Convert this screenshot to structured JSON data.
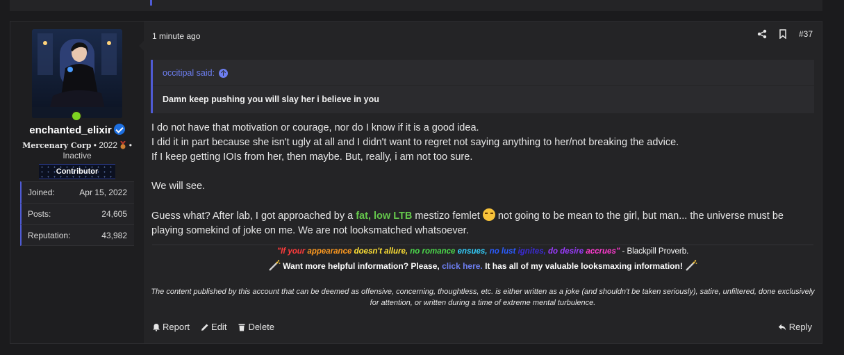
{
  "post": {
    "timestamp": "1 minute ago",
    "post_number": "#37",
    "user": {
      "name": "enchanted_elixir",
      "title_gothic": "Mercenary Corp",
      "title_rest": " • 2022 ",
      "title_end": " •",
      "status": "Inactive",
      "banner": "Contributor",
      "stats": [
        {
          "label": "Joined:",
          "value": "Apr 15, 2022"
        },
        {
          "label": "Posts:",
          "value": "24,605"
        },
        {
          "label": "Reputation:",
          "value": "43,982"
        }
      ]
    },
    "quote": {
      "author": "occitipal said:",
      "text": "Damn keep pushing you will slay her i believe in you"
    },
    "body": {
      "p1": "I do not have that motivation or courage, nor do I know if it is a good idea.",
      "p2": "I did it in part because she isn't ugly at all and I didn't want to regret not saying anything to her/not breaking the advice.",
      "p3": "If I keep getting IOIs from her, then maybe. But, really, i am not too sure.",
      "p4": "We will see.",
      "p5_start": "Guess what? After lab, I got approached by a ",
      "p5_green": "fat, low LTB",
      "p5_mid": " mestizo femlet ",
      "p5_end": " not going to be mean to the girl, but man... the universe must be playing somekind of joke on me. We are not looksmatched whatsoever."
    },
    "signature": {
      "quote_parts": [
        {
          "text": "\"If your ",
          "color": "#ff3b3b"
        },
        {
          "text": "appearance ",
          "color": "#ff9a1f"
        },
        {
          "text": "doesn't allure, ",
          "color": "#ffe135"
        },
        {
          "text": "no romance ",
          "color": "#4cd94c"
        },
        {
          "text": "ensues, ",
          "color": "#33d0ff"
        },
        {
          "text": "no lust ",
          "color": "#2b5cff"
        },
        {
          "text": "ignites, ",
          "color": "#3b2bd6"
        },
        {
          "text": "do desire ",
          "color": "#9b3bff"
        },
        {
          "text": "accrues\"",
          "color": "#ff3bd0"
        }
      ],
      "quote_source": " - Blackpill Proverb.",
      "info_start": "Want more helpful information? Please, ",
      "info_link": "click here.",
      "info_end": " It has all of my valuable looksmaxing information!",
      "disclaimer": "The content published by this account that can be deemed as offensive, concerning, thoughtless, etc. is either written as a joke (and shouldn't be taken seriously), satire, unfiltered, done exclusively for attention, or written during a time of extreme mental turbulence."
    },
    "actions": {
      "report": "Report",
      "edit": "Edit",
      "delete": "Delete",
      "reply": "Reply"
    }
  },
  "colors": {
    "accent": "#4f5bd5",
    "link": "#6d7ef0",
    "green_text": "#65c84c",
    "online": "#7ed321"
  }
}
